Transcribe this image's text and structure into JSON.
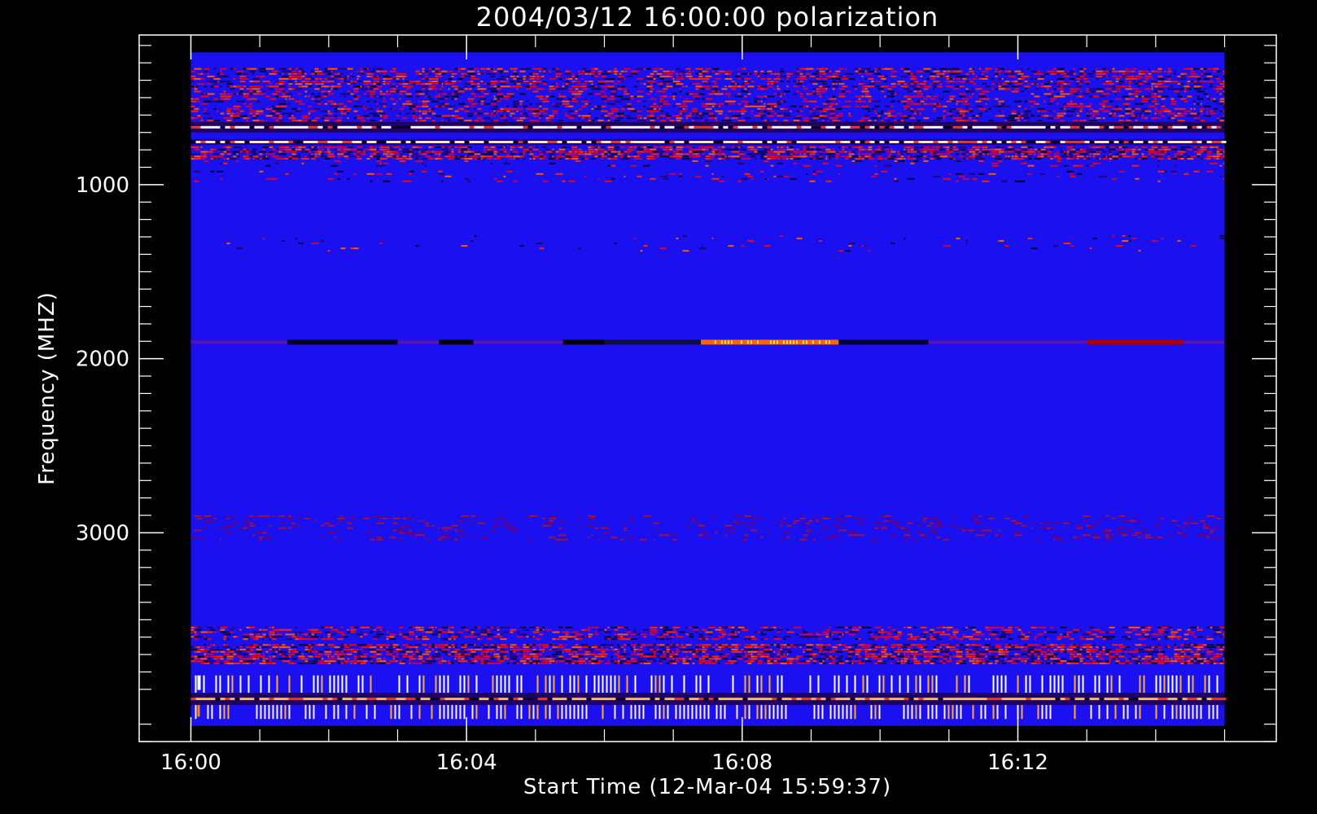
{
  "chart_data": {
    "type": "heatmap",
    "title": "2004/03/12 16:00:00 polarization",
    "xlabel": "Start Time (12-Mar-04 15:59:37)",
    "ylabel": "Frequency (MHZ)",
    "x_ticks": [
      "16:00",
      "16:04",
      "16:08",
      "16:12"
    ],
    "x_tick_minutes": [
      0,
      4,
      8,
      12
    ],
    "xlim_minutes": [
      -0.75,
      15.75
    ],
    "data_xlim_minutes": [
      0,
      15
    ],
    "y_ticks": [
      1000,
      2000,
      3000
    ],
    "ylim_mhz": [
      4200,
      140
    ],
    "data_ylim_mhz": [
      240,
      4110
    ],
    "colormap": [
      "#000000",
      "#0000ff",
      "#ff0000",
      "#ffff00",
      "#ffffff"
    ],
    "background_color": "#000000",
    "axes_color": "#ffffff",
    "base_color": "#1a10f0",
    "features": [
      {
        "mhz_range": [
          330,
          460
        ],
        "kind": "noisy",
        "density": 0.45
      },
      {
        "mhz_range": [
          460,
          560
        ],
        "kind": "noisy",
        "density": 0.3
      },
      {
        "mhz_range": [
          560,
          640
        ],
        "kind": "noisy",
        "density": 0.35
      },
      {
        "mhz_range": [
          640,
          700
        ],
        "kind": "bright-line",
        "color": "#ffffff"
      },
      {
        "mhz_range": [
          740,
          770
        ],
        "kind": "bright-line",
        "color": "#ffee88"
      },
      {
        "mhz_range": [
          780,
          860
        ],
        "kind": "noisy",
        "density": 0.6
      },
      {
        "mhz_range": [
          860,
          900
        ],
        "kind": "sparse",
        "density": 0.08
      },
      {
        "mhz_range": [
          920,
          990
        ],
        "kind": "sparse",
        "density": 0.06
      },
      {
        "mhz_range": [
          1290,
          1390
        ],
        "kind": "sparse",
        "density": 0.03
      },
      {
        "mhz_range": [
          1890,
          1920
        ],
        "kind": "burst-line",
        "color": "#ff6600"
      },
      {
        "mhz_range": [
          2900,
          3050
        ],
        "kind": "faint",
        "density": 0.12
      },
      {
        "mhz_range": [
          3540,
          3620
        ],
        "kind": "noisy",
        "density": 0.35
      },
      {
        "mhz_range": [
          3640,
          3760
        ],
        "kind": "noisy",
        "density": 0.6
      },
      {
        "mhz_range": [
          3820,
          3920
        ],
        "kind": "bars",
        "density": 0.5,
        "color": "#ffffff"
      },
      {
        "mhz_range": [
          3920,
          3990
        ],
        "kind": "bright-line",
        "color": "#ffbb44"
      },
      {
        "mhz_range": [
          3990,
          4070
        ],
        "kind": "bars",
        "density": 0.6,
        "color": "#ffeedd"
      }
    ]
  }
}
